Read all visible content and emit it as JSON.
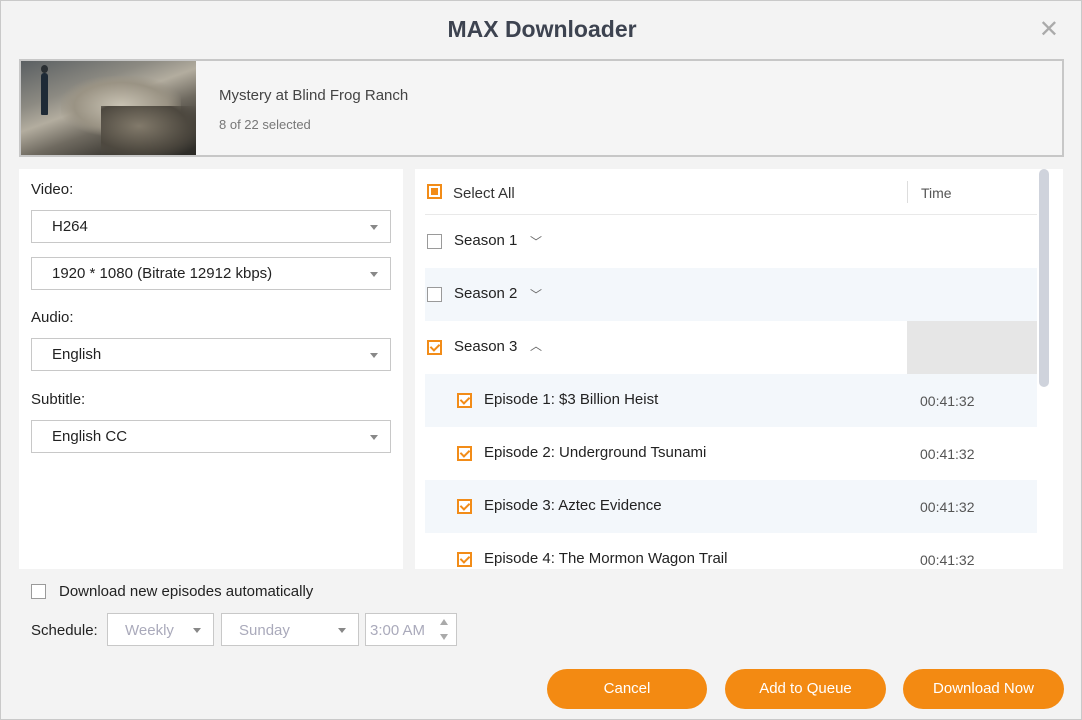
{
  "window": {
    "title": "MAX Downloader"
  },
  "show": {
    "title": "Mystery at Blind Frog Ranch",
    "selected": "8 of 22 selected"
  },
  "settings": {
    "video_label": "Video:",
    "codec": "H264",
    "resolution": "1920 * 1080 (Bitrate 12912 kbps)",
    "audio_label": "Audio:",
    "audio": "English",
    "subtitle_label": "Subtitle:",
    "subtitle": "English CC"
  },
  "list": {
    "select_all": "Select All",
    "time_header": "Time",
    "seasons": [
      {
        "label": "Season 1",
        "checked": false,
        "expanded": false
      },
      {
        "label": "Season 2",
        "checked": false,
        "expanded": false
      },
      {
        "label": "Season 3",
        "checked": true,
        "expanded": true
      }
    ],
    "episodes": [
      {
        "label": "Episode 1: $3 Billion Heist",
        "time": "00:41:32",
        "checked": true
      },
      {
        "label": "Episode 2: Underground Tsunami",
        "time": "00:41:32",
        "checked": true
      },
      {
        "label": "Episode 3: Aztec Evidence",
        "time": "00:41:32",
        "checked": true
      },
      {
        "label": "Episode 4: The Mormon Wagon Trail",
        "time": "00:41:32",
        "checked": true
      }
    ]
  },
  "schedule": {
    "auto_label": "Download new episodes automatically",
    "label": "Schedule:",
    "frequency": "Weekly",
    "day": "Sunday",
    "time": "3:00 AM"
  },
  "buttons": {
    "cancel": "Cancel",
    "queue": "Add to Queue",
    "download": "Download Now"
  },
  "colors": {
    "accent": "#f38a12"
  }
}
